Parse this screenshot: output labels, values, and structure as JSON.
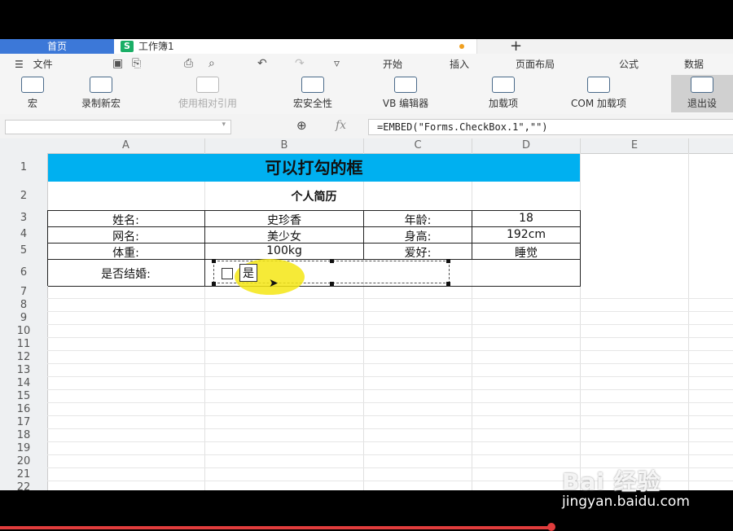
{
  "tabs": {
    "home": "首页",
    "doc_icon": "S",
    "doc": "工作簿1",
    "new_tab": "+"
  },
  "menu": {
    "file": "文件",
    "items": [
      "开始",
      "插入",
      "页面布局",
      "公式",
      "数据"
    ]
  },
  "quick_icons": [
    "save-icon",
    "format-painter-icon",
    "print-icon",
    "print-preview-icon",
    "undo-icon",
    "redo-icon",
    "dropdown-icon"
  ],
  "ribbon": [
    {
      "label": "宏",
      "enabled": true
    },
    {
      "label": "录制新宏",
      "enabled": true
    },
    {
      "label": "使用相对引用",
      "enabled": false
    },
    {
      "label": "宏安全性",
      "enabled": true
    },
    {
      "label": "VB 编辑器",
      "enabled": true
    },
    {
      "label": "加载项",
      "enabled": true
    },
    {
      "label": "COM 加载项",
      "enabled": true
    },
    {
      "label": "退出设",
      "enabled": true,
      "active": true
    }
  ],
  "formula_bar": {
    "zoom_icon": "⊕",
    "fx": "fx",
    "formula": "=EMBED(\"Forms.CheckBox.1\",\"\")"
  },
  "columns": [
    "A",
    "B",
    "C",
    "D",
    "E"
  ],
  "rows": [
    "1",
    "2",
    "3",
    "4",
    "5",
    "6",
    "7",
    "8",
    "9",
    "10",
    "11",
    "12",
    "13",
    "14",
    "15",
    "16",
    "17",
    "18",
    "19",
    "20",
    "21",
    "22"
  ],
  "sheet": {
    "title": "可以打勾的框",
    "subtitle": "个人简历",
    "r3": {
      "a": "姓名:",
      "b": "史珍香",
      "c": "年龄:",
      "d": "18"
    },
    "r4": {
      "a": "网名:",
      "b": "美少女",
      "c": "身高:",
      "d": "192cm"
    },
    "r5": {
      "a": "体重:",
      "b": "100kg",
      "c": "爱好:",
      "d": "睡觉"
    },
    "r6": {
      "a": "是否结婚:"
    },
    "title_color": "#00b0f0"
  },
  "checkbox": {
    "label": "是",
    "checked": false
  },
  "watermark": {
    "logo": "Bai 经验",
    "site": "jingyan.baidu.com"
  }
}
